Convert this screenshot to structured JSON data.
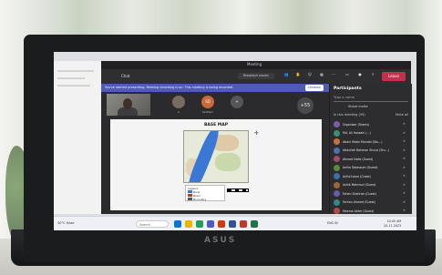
{
  "colors": {
    "teams_bg": "#2b2b2d",
    "banner": "#4f5bb5",
    "leave": "#c4314b",
    "river": "#3b78d6",
    "taskbar": "#eef0f5"
  },
  "laptop": {
    "brand": "ASUS"
  },
  "meeting": {
    "window_title": "Meeting",
    "toolbar_title": "Chat",
    "search_label": "Breakout rooms",
    "toolbar_buttons": [
      {
        "label": "People",
        "icon": "people-icon"
      },
      {
        "label": "Raise",
        "icon": "hand-icon"
      },
      {
        "label": "React",
        "icon": "smile-icon"
      },
      {
        "label": "View",
        "icon": "grid-icon"
      },
      {
        "label": "More",
        "icon": "more-icon"
      },
      {
        "label": "Camera",
        "icon": "camera-icon"
      },
      {
        "label": "Mic",
        "icon": "mic-icon"
      },
      {
        "label": "Share",
        "icon": "share-icon"
      }
    ],
    "leave_label": "Leave",
    "banner_text": "You've started presenting. Meeting recording is on. This meeting is being recorded.",
    "banner_button": "Dismiss",
    "participants_tiles": [
      {
        "name": "A",
        "initials": "",
        "color": "#7a6b60"
      },
      {
        "name": "Saddam",
        "initials": "SD",
        "color": "#c9693a"
      },
      {
        "name": "",
        "initials": "+",
        "color": "#55555a"
      }
    ],
    "overflow_count": "+55",
    "shared_screen": {
      "map_title": "BASE MAP",
      "legend_title": "Legend",
      "legend_items": [
        "River",
        "Road",
        "Boundary"
      ]
    }
  },
  "panel": {
    "title": "Participants",
    "search_placeholder": "Type a name",
    "share_invite": "Share invite",
    "section_label": "In this meeting (55)",
    "mute_all": "Mute all",
    "people": [
      {
        "name": "Organiser (Teams)",
        "color": "#7b5ea7"
      },
      {
        "name": "Md. Ali Hossain (...)",
        "color": "#3a8f72"
      },
      {
        "name": "Abdul Matin Mondal (Stu...)",
        "color": "#c2723b"
      },
      {
        "name": "Abdullah Rahman Shuvo (Stu...)",
        "color": "#4a72b0"
      },
      {
        "name": "Ahmed Nafiz (Guest)",
        "color": "#a34b6a"
      },
      {
        "name": "Anika Tabassum (Guest)",
        "color": "#5b8a3a"
      },
      {
        "name": "Ariful Islam (Guest)",
        "color": "#3b6fa5"
      },
      {
        "name": "Ashik Mahmud (Guest)",
        "color": "#a0653a"
      },
      {
        "name": "Fahim Shahriar (Guest)",
        "color": "#6a5aa8"
      },
      {
        "name": "Farhan Ahmed (Guest)",
        "color": "#2f8a8a"
      },
      {
        "name": "Fatema Akter (Guest)",
        "color": "#b04a4a"
      },
      {
        "name": "Habibur Rahman (Guest)",
        "color": "#4d7d3a"
      }
    ]
  },
  "taskbar": {
    "weather": "30°C Haze",
    "search": "Search",
    "tray": "ENG  IN",
    "time": "10:45 AM",
    "date": "20-11-2023"
  }
}
